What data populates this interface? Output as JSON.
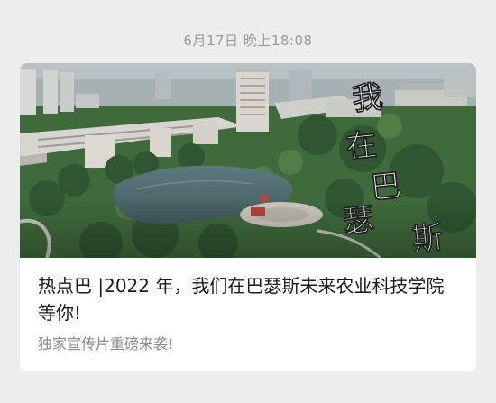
{
  "chat": {
    "timestamp": "6月17日 晚上18:08"
  },
  "article_card": {
    "cover_overlay_text": "我在巴瑟斯",
    "title": "热点巴 |2022 年，我们在巴瑟斯未来农业科技学院等你!",
    "summary": "独家宣传片重磅来袭!",
    "colors": {
      "card_background": "#ffffff",
      "page_background": "#ededed",
      "title_text": "#1a1a1a",
      "summary_text": "#8a8a8a",
      "timestamp_text": "#9b9b9b"
    }
  }
}
